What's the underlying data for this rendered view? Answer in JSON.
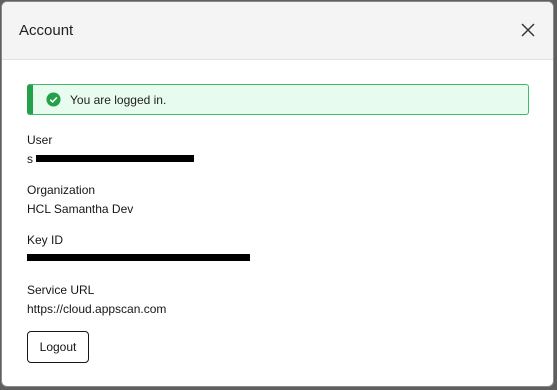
{
  "dialog": {
    "title": "Account",
    "close_icon": "close-icon"
  },
  "alert": {
    "icon": "check-circle-icon",
    "message": "You are logged in.",
    "color": "#24a148"
  },
  "fields": {
    "user_label": "User",
    "user_value_prefix": "s",
    "org_label": "Organization",
    "org_value": "HCL Samantha Dev",
    "key_label": "Key ID",
    "service_label": "Service URL",
    "service_value": "https://cloud.appscan.com"
  },
  "actions": {
    "logout_label": "Logout"
  }
}
